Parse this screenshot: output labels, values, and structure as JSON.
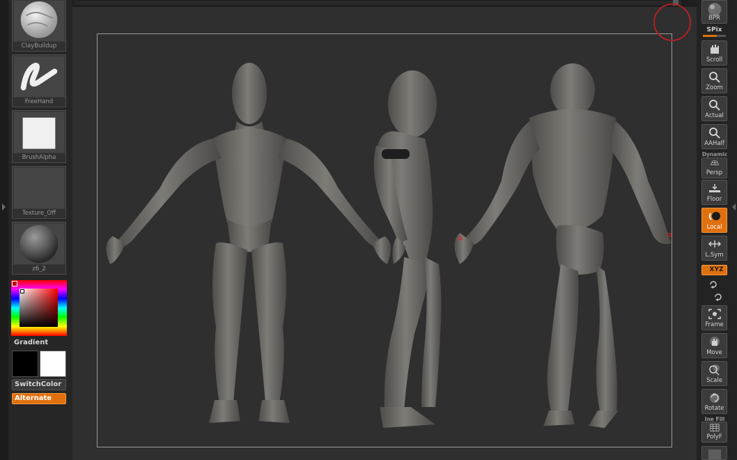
{
  "left_panel": {
    "brush": {
      "label": "ClayBuildup"
    },
    "stroke": {
      "label": "FreeHand"
    },
    "alpha": {
      "label": "BrushAlpha"
    },
    "texture": {
      "label": "Texture_Off"
    },
    "material": {
      "label": "z6_2"
    },
    "gradient_label": "Gradient",
    "main_color": "#000000",
    "secondary_color": "#ffffff",
    "switch_color_label": "SwitchColor",
    "alternate_label": "Alternate"
  },
  "right_shelf": {
    "bpr_label": "BPR",
    "spix_label": "SPix",
    "buttons": [
      {
        "label": "Scroll"
      },
      {
        "label": "Zoom"
      },
      {
        "label": "Actual"
      },
      {
        "label": "AAHalf"
      },
      {
        "label": "Persp",
        "caption": "Dynamic"
      },
      {
        "label": "Floor"
      },
      {
        "label": "Local"
      },
      {
        "label": "L.Sym"
      },
      {
        "label": "Frame"
      },
      {
        "label": "Move"
      },
      {
        "label": "Scale"
      },
      {
        "label": "Rotate"
      },
      {
        "label": "PolyF",
        "caption": "Ine Fill"
      }
    ],
    "xyz_label": "XYZ"
  },
  "colors": {
    "accent_orange": "#e0700e",
    "canvas": "#2f2f2f",
    "model_clay": "#6f6e6a"
  },
  "icons": [
    "scroll-hand-icon",
    "zoom-icon",
    "actual-icon",
    "aahalf-icon",
    "persp-grid-icon",
    "floor-icon",
    "local-icon",
    "lsym-icon",
    "frame-icon",
    "move-icon",
    "scale-icon",
    "rotate-icon",
    "polyf-icon"
  ]
}
